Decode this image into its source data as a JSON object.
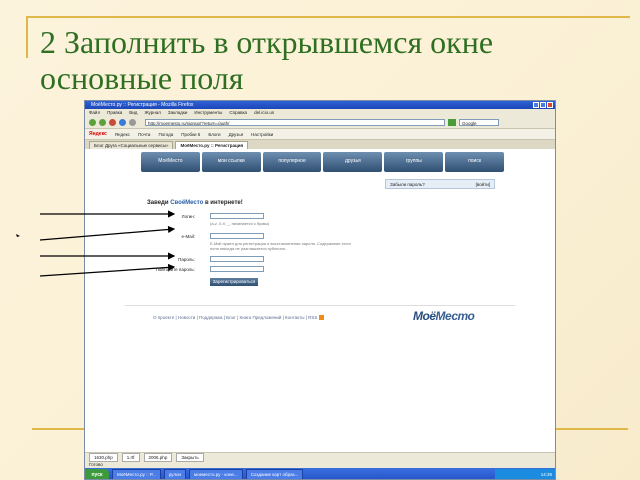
{
  "slide": {
    "title": "2 Заполнить в открывшемся окне основные поля"
  },
  "browser": {
    "window_title": "МоёМесто.ру :: Регистрация - Mozilla Firefox",
    "menu": [
      "Файл",
      "Правка",
      "Вид",
      "Журнал",
      "Закладки",
      "Инструменты",
      "Справка",
      "del.icio.us"
    ],
    "address": "http://moemesto.ru/signup/?return=/auth/",
    "search_placeholder": "Google",
    "yandex_bar": {
      "logo": "Яндекс",
      "items": [
        "Яндекс",
        "Почта",
        "Погода",
        "Пробки 5",
        "Блоги",
        "Друзья",
        "Настройки"
      ]
    },
    "tabs": [
      "Блог Друга «Социальные сервисы»",
      "МоёМесто.ру :: Регистрация"
    ],
    "status": "Готово"
  },
  "site": {
    "nav": [
      "МоёМесто",
      "мои ссылки",
      "популярное",
      "друзья",
      "группы",
      "поиск"
    ],
    "forgot": {
      "label": "Забыли пароль?",
      "action": "[войти]"
    },
    "heading": {
      "prefix": "Заведи ",
      "brand": "СвоёМесто",
      "suffix": " в интернете!"
    },
    "form": {
      "login_label": "Логин:",
      "login_hint": "(a-z, 0-9, _, начинается с буквы)",
      "email_label": "e-Mail:",
      "email_hint": "E-Mail нужен для регистрации и восстановления пароля. Содержание этого поля никогда не разглашается публично.",
      "password_label": "Пароль:",
      "password2_label": "Повторите пароль:",
      "submit": "Зарегистрироваться"
    },
    "footer": "О проекте | Новости | Поддержка | Блог | Книга Предложений | Контакты | RSS",
    "logo": {
      "part1": "Моё",
      "part2": "Место"
    }
  },
  "downloads": [
    "1630.php",
    "1.rtf",
    "2006.php",
    "Закрыть"
  ],
  "taskbar": {
    "start": "пуск",
    "tasks": [
      "МоёМесто.ру :: Р...",
      "рулон",
      "моеместо.ру - коне...",
      "Создание карт образ..."
    ],
    "clock": "14:39"
  }
}
